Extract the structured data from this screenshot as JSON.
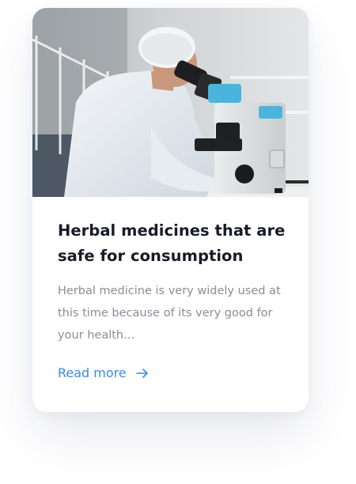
{
  "card": {
    "image_alt": "Scientist in lab coat and hairnet looking through a microscope",
    "title": "Herbal medicines that are safe for consumption",
    "description": "Herbal medicine is very widely used at this time because of its very good for your health...",
    "read_more_label": "Read more",
    "read_more_icon": "arrow-right-icon",
    "accent_color": "#3b8ae6"
  }
}
